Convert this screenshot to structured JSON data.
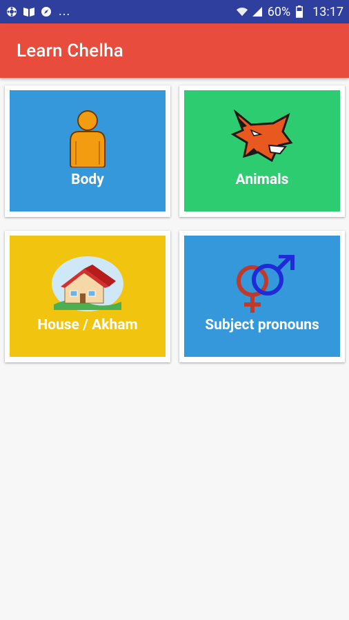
{
  "status_bar": {
    "notification_icons": [
      "settings-cog-icon",
      "book-icon",
      "compass-icon"
    ],
    "overflow": "...",
    "battery_percent": "60%",
    "time": "13:17"
  },
  "app_bar": {
    "title": "Learn Chelha"
  },
  "categories": [
    {
      "label": "Body",
      "icon": "person-icon",
      "color": "#3498db"
    },
    {
      "label": "Animals",
      "icon": "wolf-icon",
      "color": "#2ecc71"
    },
    {
      "label": "House / Akham",
      "icon": "house-icon",
      "color": "#f1c40f"
    },
    {
      "label": "Subject pronouns",
      "icon": "gender-symbols-icon",
      "color": "#3498db"
    }
  ],
  "colors": {
    "status_bar": "#2f3f9e",
    "app_bar": "#e74c3c",
    "background": "#f7f7f7"
  }
}
